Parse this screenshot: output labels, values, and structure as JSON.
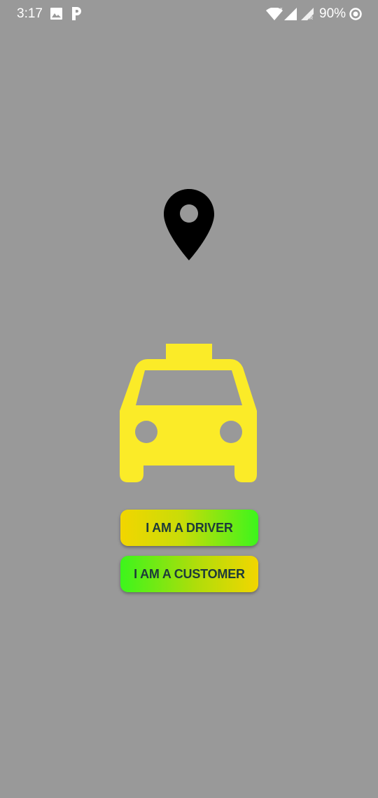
{
  "status_bar": {
    "time": "3:17",
    "battery_percent": "90%",
    "icons": [
      "image-icon",
      "p-notification-icon",
      "wifi-icon",
      "signal-icon",
      "signal-roaming-icon",
      "battery-icon"
    ]
  },
  "main": {
    "pin_icon": "map-pin-icon",
    "car_icon": "taxi-icon",
    "driver_button_label": "I AM A DRIVER",
    "customer_button_label": "I AM A CUSTOMER"
  },
  "colors": {
    "background": "#999999",
    "taxi": "#fbeb28",
    "button_yellow": "#f2d600",
    "button_green": "#3cf51c",
    "button_text": "#1e3a3a"
  }
}
